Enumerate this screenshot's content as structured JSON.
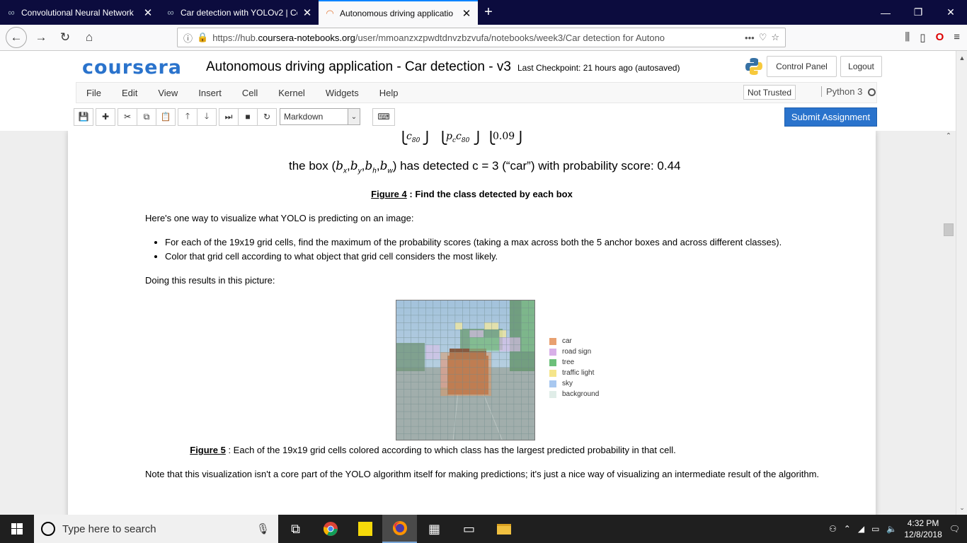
{
  "browser": {
    "tabs": [
      {
        "title": "Convolutional Neural Network",
        "icon": "infinity-icon"
      },
      {
        "title": "Car detection with YOLOv2 | Co",
        "icon": "infinity-icon"
      },
      {
        "title": "Autonomous driving applicatio",
        "icon": "loading-icon",
        "active": true
      }
    ],
    "url_prefix": "https://hub.",
    "url_domain": "coursera-notebooks.org",
    "url_path": "/user/mmoanzxzpwdtdnvzbzvufa/notebooks/week3/Car detection for Autono",
    "url_more": "•••"
  },
  "jupyter": {
    "logo": "coursera",
    "notebook_title": "Autonomous driving application - Car detection - v3",
    "checkpoint": "Last Checkpoint: 21 hours ago (autosaved)",
    "control_panel": "Control Panel",
    "logout": "Logout",
    "menu": [
      "File",
      "Edit",
      "View",
      "Insert",
      "Cell",
      "Kernel",
      "Widgets",
      "Help"
    ],
    "trusted": "Not Trusted",
    "kernel": "Python 3",
    "cell_type": "Markdown",
    "submit": "Submit Assignment"
  },
  "notebook": {
    "matrix_c80": "c",
    "matrix_c80_sub": "80",
    "matrix_pc": "p",
    "matrix_pc_sub": "c",
    "matrix_pc_c": "c",
    "matrix_pc_c_sub": "80",
    "matrix_value": "0.09",
    "formula_pre": "the box (",
    "formula_vars": [
      "b",
      "b",
      "b",
      "b"
    ],
    "formula_subs": [
      "x",
      "y",
      "h",
      "w"
    ],
    "formula_post": ") has detected c = 3 (“car”) with probability score: 0.44",
    "fig4_label": "Figure 4",
    "fig4_text": ": Find the class detected by each box",
    "intro": "Here's one way to visualize what YOLO is predicting on an image:",
    "bullets": [
      "For each of the 19x19 grid cells, find the maximum of the probability scores (taking a max across both the 5 anchor boxes and across different classes).",
      "Color that grid cell according to what object that grid cell considers the most likely."
    ],
    "doing": "Doing this results in this picture:",
    "legend": [
      {
        "label": "car",
        "color": "#e8a070"
      },
      {
        "label": "road sign",
        "color": "#d8b0e8"
      },
      {
        "label": "tree",
        "color": "#6cc07a"
      },
      {
        "label": "traffic light",
        "color": "#f5e58a"
      },
      {
        "label": "sky",
        "color": "#a8c8f0"
      },
      {
        "label": "background",
        "color": "#e0ede8"
      }
    ],
    "fig5_label": "Figure 5",
    "fig5_text": ": Each of the 19x19 grid cells colored according to which class has the largest predicted probability in that cell.",
    "note": "Note that this visualization isn't a core part of the YOLO algorithm itself for making predictions; it's just a nice way of visualizing an intermediate result of the algorithm."
  },
  "taskbar": {
    "search_placeholder": "Type here to search",
    "time": "4:32 PM",
    "date": "12/8/2018"
  }
}
